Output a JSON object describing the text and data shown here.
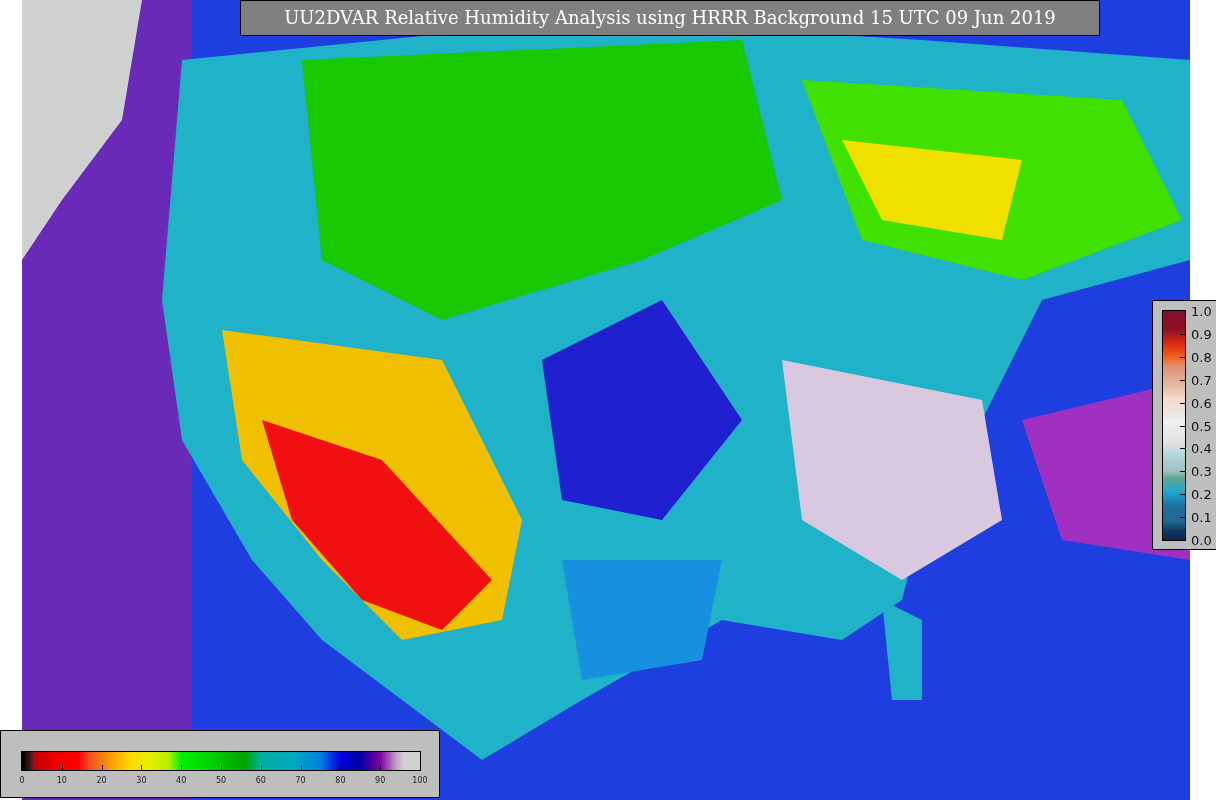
{
  "title": "UU2DVAR Relative Humidity Analysis using HRRR Background 15 UTC 09 Jun 2019",
  "station_colorbar": {
    "ticks": [
      "1.0",
      "0.9",
      "0.8",
      "0.7",
      "0.6",
      "0.5",
      "0.4",
      "0.3",
      "0.2",
      "0.1",
      "0.0"
    ]
  },
  "humidity_colorbar": {
    "ticks": [
      "0",
      "10",
      "20",
      "30",
      "40",
      "50",
      "60",
      "70",
      "80",
      "90",
      "100"
    ]
  }
}
